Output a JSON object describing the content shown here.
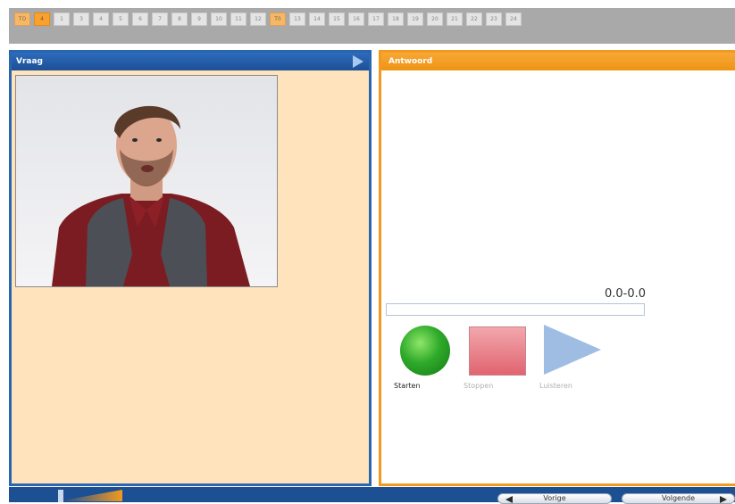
{
  "tabs": [
    "TO",
    "4",
    "1",
    "3",
    "4",
    "5",
    "6",
    "7",
    "8",
    "9",
    "10",
    "11",
    "12",
    "T0",
    "13",
    "14",
    "15",
    "16",
    "17",
    "18",
    "19",
    "20",
    "21",
    "22",
    "23",
    "24"
  ],
  "question_panel": {
    "title": "Vraag"
  },
  "answer_panel": {
    "title": "Antwoord",
    "time_readout": "0.0-0.0",
    "progress_fraction": 0,
    "controls": {
      "record_label": "Starten",
      "stop_label": "Stoppen",
      "listen_label": "Luisteren"
    }
  },
  "bottom_bar": {
    "prev_label": "Vorige",
    "next_label": "Volgende"
  },
  "colors": {
    "accent_orange": "#f29a1e",
    "primary_blue": "#1d4f93",
    "question_bg": "#ffe3bd"
  }
}
